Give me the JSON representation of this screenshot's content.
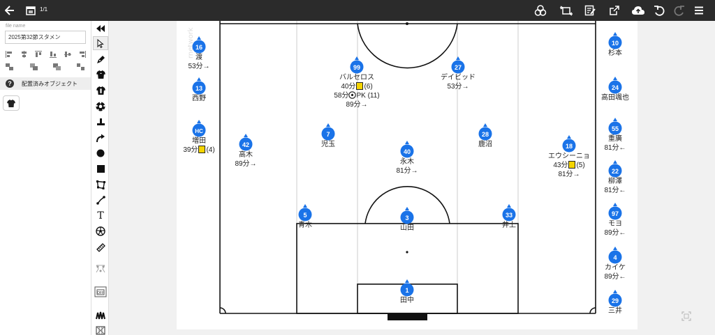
{
  "topbar": {
    "page_indicator": "1/1",
    "icons": [
      "back-arrow-icon",
      "calendar-icon",
      "venn-icon",
      "substitution-icon",
      "edit-note-icon",
      "share-icon",
      "cloud-upload-icon",
      "undo-icon",
      "redo-icon",
      "menu-icon"
    ]
  },
  "leftpanel": {
    "file_label": "file name",
    "file_value": "2025第32節スタメン",
    "placed_label": "配置済みオブジェクト"
  },
  "tools": [
    "collapse-icon",
    "pointer-icon",
    "pen-icon",
    "shirt-icon",
    "shirt-outline-icon",
    "ball-icon",
    "cone-icon",
    "curved-arrow-icon",
    "circle-icon",
    "square-icon",
    "polygon-icon",
    "line-icon",
    "text-icon",
    "ball-outline-icon",
    "ruler-icon",
    "formation-icon",
    "off-toggle-icon",
    "crowd-icon",
    "net-icon"
  ],
  "tool_text": {
    "text_tool": "T",
    "off_label": "OFF"
  },
  "watermark": "rnetwork",
  "colors": {
    "pin": "#1a73e8",
    "card": "#f5d400",
    "topbar": "#2b2b2b"
  },
  "players": {
    "p16": {
      "num": "16",
      "name": "渡",
      "ev1": "53分→"
    },
    "p13": {
      "num": "13",
      "name": "西野"
    },
    "phc": {
      "num": "HC",
      "name": "増田",
      "ev1_a": "39分",
      "ev1_b": "(4)"
    },
    "p42": {
      "num": "42",
      "name": "高木",
      "ev1": "89分→"
    },
    "p99": {
      "num": "99",
      "name": "バルセロス",
      "ev1_a": "40分",
      "ev1_b": "(6)",
      "ev2_a": "58分",
      "ev2_b": "PK (11)",
      "ev3": "89分→"
    },
    "p27": {
      "num": "27",
      "name": "デイビッド",
      "ev1": "53分→"
    },
    "p7": {
      "num": "7",
      "name": "児玉"
    },
    "p40": {
      "num": "40",
      "name": "永木",
      "ev1": "81分→"
    },
    "p28": {
      "num": "28",
      "name": "鹿沼"
    },
    "p18": {
      "num": "18",
      "name": "エウシーニョ",
      "ev1_a": "43分",
      "ev1_b": "(5)",
      "ev2": "81分→"
    },
    "p5": {
      "num": "5",
      "name": "青木"
    },
    "p3": {
      "num": "3",
      "name": "山田"
    },
    "p33": {
      "num": "33",
      "name": "井上"
    },
    "p1": {
      "num": "1",
      "name": "田中"
    },
    "p10": {
      "num": "10",
      "name": "杉本"
    },
    "p24": {
      "num": "24",
      "name": "高田颯也"
    },
    "p55": {
      "num": "55",
      "name": "重廣",
      "ev1": "81分←"
    },
    "p22": {
      "num": "22",
      "name": "柳澤",
      "ev1": "81分←"
    },
    "p97": {
      "num": "97",
      "name": "モヨ",
      "ev1": "89分←"
    },
    "p4": {
      "num": "4",
      "name": "カイケ",
      "ev1": "89分←"
    },
    "p29": {
      "num": "29",
      "name": "三井"
    }
  }
}
